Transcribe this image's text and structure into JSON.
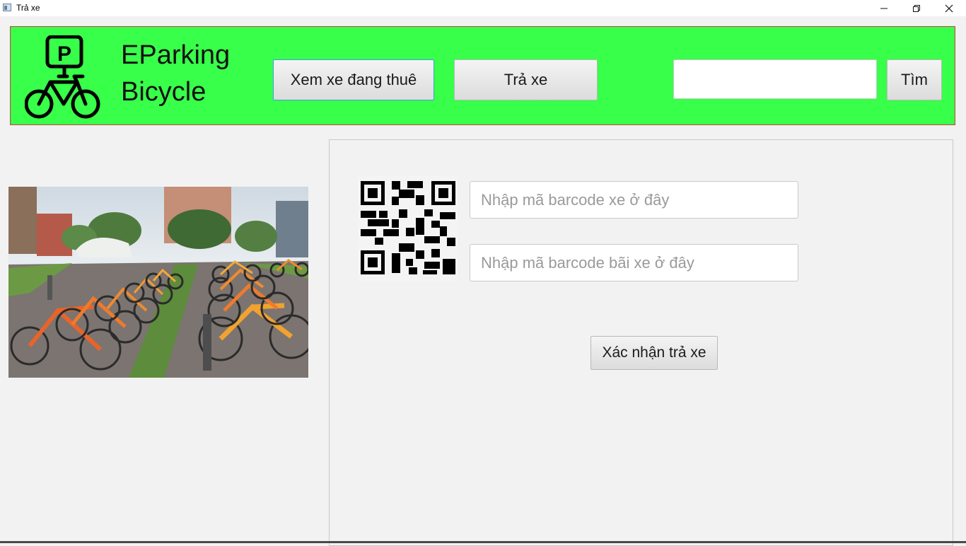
{
  "window": {
    "title": "Trả xe",
    "minimize_icon": "minimize-icon",
    "maximize_icon": "restore-icon",
    "close_icon": "close-icon"
  },
  "header": {
    "brand_line1": "EParking",
    "brand_line2": "Bicycle",
    "logo_icon": "parking-bicycle-icon",
    "rented_button": "Xem xe đang thuê",
    "return_button": "Trả xe",
    "search_value": "",
    "search_button": "Tìm",
    "background_color": "#38ff49",
    "border_color": "#c6433f"
  },
  "photo": {
    "icon": "bike-station-photo"
  },
  "return_panel": {
    "qr_icon": "qr-code-icon",
    "bike_barcode_placeholder": "Nhập mã barcode xe ở đây",
    "dock_barcode_placeholder": "Nhập mã barcode bãi xe ở đây",
    "confirm_button": "Xác nhận trả xe"
  }
}
